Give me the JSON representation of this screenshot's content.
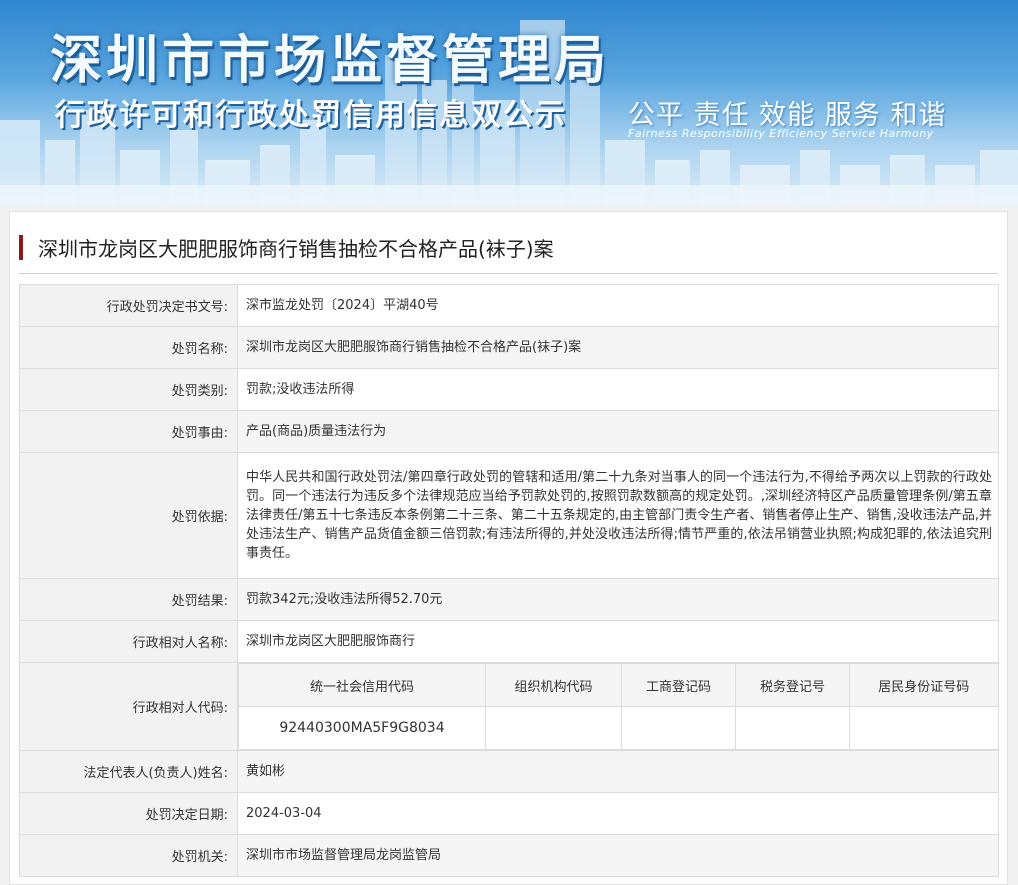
{
  "banner": {
    "title": "深圳市市场监督管理局",
    "subtitle": "行政许可和行政处罚信用信息双公示",
    "slogan": "公平 责任 效能 服务 和谐",
    "slogan_en": "Fairness Responsibility Efficiency Service Harmony"
  },
  "case": {
    "title": "深圳市龙岗区大肥肥服饰商行销售抽检不合格产品(袜子)案"
  },
  "fields": {
    "doc_no": {
      "label": "行政处罚决定书文号:",
      "value": "深市监龙处罚〔2024〕平湖40号"
    },
    "name": {
      "label": "处罚名称:",
      "value": "深圳市龙岗区大肥肥服饰商行销售抽检不合格产品(袜子)案"
    },
    "category": {
      "label": "处罚类别:",
      "value": "罚款;没收违法所得"
    },
    "cause": {
      "label": "处罚事由:",
      "value": "产品(商品)质量违法行为"
    },
    "basis": {
      "label": "处罚依据:",
      "value": "中华人民共和国行政处罚法/第四章行政处罚的管辖和适用/第二十九条对当事人的同一个违法行为,不得给予两次以上罚款的行政处罚。同一个违法行为违反多个法律规范应当给予罚款处罚的,按照罚款数额高的规定处罚。,深圳经济特区产品质量管理条例/第五章法律责任/第五十七条违反本条例第二十三条、第二十五条规定的,由主管部门责令生产者、销售者停止生产、销售,没收违法产品,并处违法生产、销售产品货值金额三倍罚款;有违法所得的,并处没收违法所得;情节严重的,依法吊销营业执照;构成犯罪的,依法追究刑事责任。"
    },
    "result": {
      "label": "处罚结果:",
      "value": "罚款342元;没收违法所得52.70元"
    },
    "party_name": {
      "label": "行政相对人名称:",
      "value": "深圳市龙岗区大肥肥服饰商行"
    },
    "party_code": {
      "label": "行政相对人代码:",
      "headers": [
        "统一社会信用代码",
        "组织机构代码",
        "工商登记码",
        "税务登记号",
        "居民身份证号码"
      ],
      "values": [
        "92440300MA5F9G8034",
        "",
        "",
        "",
        ""
      ]
    },
    "legal_rep": {
      "label": "法定代表人(负责人)姓名:",
      "value": "黄如彬"
    },
    "decision_date": {
      "label": "处罚决定日期:",
      "value": "2024-03-04"
    },
    "authority": {
      "label": "处罚机关:",
      "value": "深圳市市场监督管理局龙岗监管局"
    }
  }
}
